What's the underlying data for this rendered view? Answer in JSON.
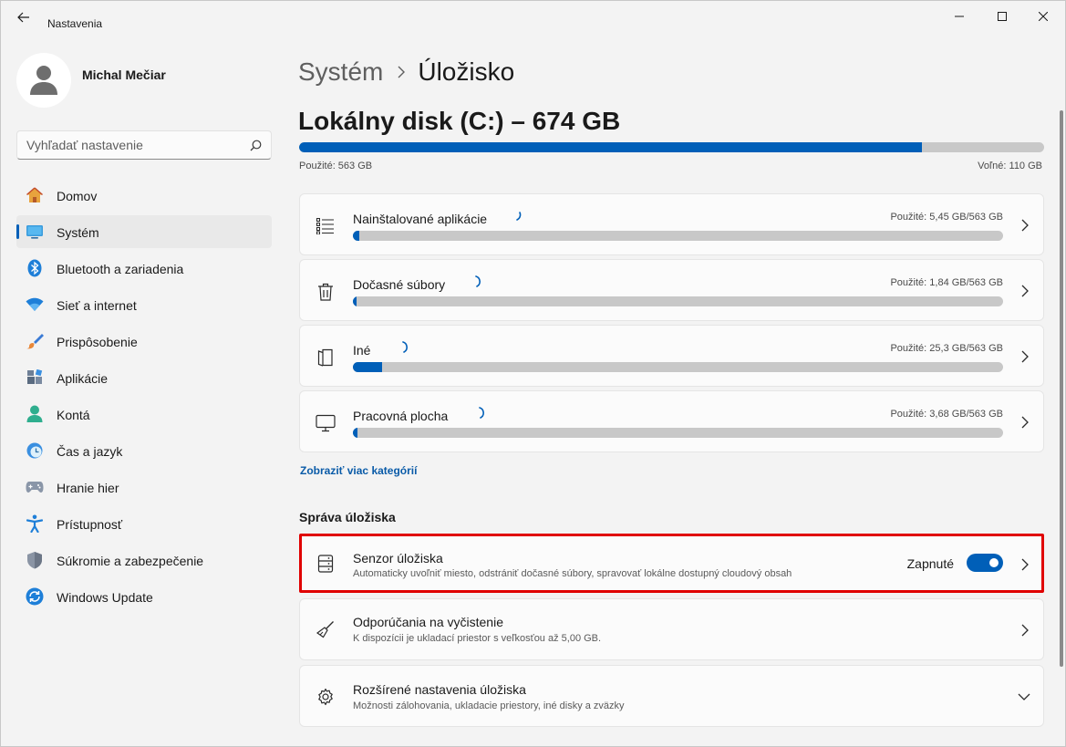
{
  "window": {
    "title": "Nastavenia"
  },
  "user": {
    "name": "Michal Mečiar"
  },
  "search": {
    "placeholder": "Vyhľadať nastavenie"
  },
  "sidebar": {
    "items": [
      {
        "label": "Domov",
        "icon": "home-icon"
      },
      {
        "label": "Systém",
        "icon": "system-icon",
        "active": true
      },
      {
        "label": "Bluetooth a zariadenia",
        "icon": "bluetooth-icon"
      },
      {
        "label": "Sieť a internet",
        "icon": "wifi-icon"
      },
      {
        "label": "Prispôsobenie",
        "icon": "brush-icon"
      },
      {
        "label": "Aplikácie",
        "icon": "apps-icon"
      },
      {
        "label": "Kontá",
        "icon": "account-icon"
      },
      {
        "label": "Čas a jazyk",
        "icon": "clock-globe-icon"
      },
      {
        "label": "Hranie hier",
        "icon": "gamepad-icon"
      },
      {
        "label": "Prístupnosť",
        "icon": "accessibility-icon"
      },
      {
        "label": "Súkromie a zabezpečenie",
        "icon": "shield-icon"
      },
      {
        "label": "Windows Update",
        "icon": "update-icon"
      }
    ]
  },
  "breadcrumb": {
    "parent": "Systém",
    "current": "Úložisko"
  },
  "disk": {
    "title": "Lokálny disk (C:) – 674 GB",
    "used_label": "Použité: 563 GB",
    "free_label": "Voľné: 110 GB",
    "used_fraction": 0.836
  },
  "categories": [
    {
      "label": "Nainštalované aplikácie",
      "usage": "Použité: 5,45 GB/563 GB",
      "fraction": 0.0097,
      "icon": "list-icon"
    },
    {
      "label": "Dočasné súbory",
      "usage": "Použité: 1,84 GB/563 GB",
      "fraction": 0.0033,
      "icon": "trash-icon"
    },
    {
      "label": "Iné",
      "usage": "Použité: 25,3 GB/563 GB",
      "fraction": 0.045,
      "icon": "document-icon"
    },
    {
      "label": "Pracovná plocha",
      "usage": "Použité: 3,68 GB/563 GB",
      "fraction": 0.0065,
      "icon": "monitor-icon"
    }
  ],
  "more_categories_link": "Zobraziť viac kategórií",
  "management": {
    "title": "Správa úložiska",
    "items": [
      {
        "title": "Senzor úložiska",
        "desc": "Automaticky uvoľniť miesto, odstrániť dočasné súbory, spravovať lokálne dostupný cloudový obsah",
        "toggle_label": "Zapnuté",
        "toggle_on": true,
        "icon": "storage-sense-icon"
      },
      {
        "title": "Odporúčania na vyčistenie",
        "desc": "K dispozícii je ukladací priestor s veľkosťou až 5,00 GB.",
        "icon": "broom-icon"
      },
      {
        "title": "Rozšírené nastavenia úložiska",
        "desc": "Možnosti zálohovania, ukladacie priestory, iné disky a zväzky",
        "icon": "gear-icon"
      }
    ]
  },
  "colors": {
    "accent": "#005fb8",
    "highlight": "#e00000",
    "track": "#c8c8c8"
  }
}
